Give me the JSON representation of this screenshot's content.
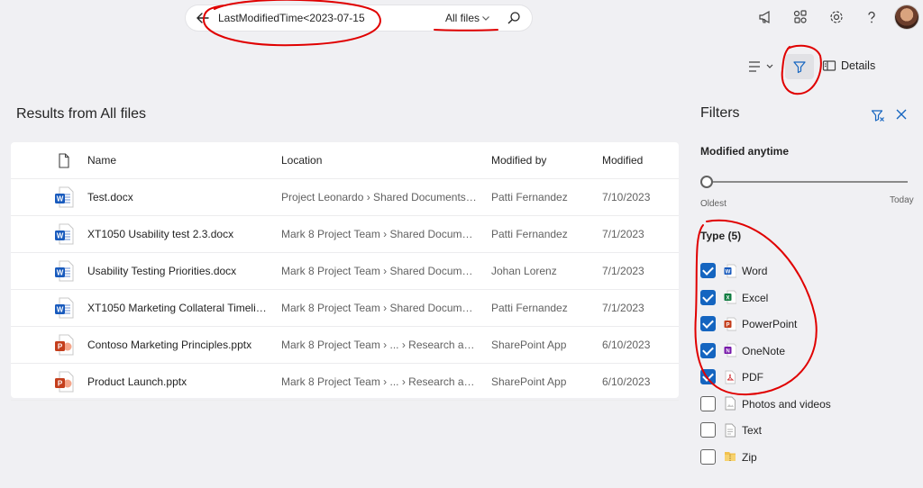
{
  "search": {
    "query": "LastModifiedTime<2023-07-15",
    "scope": "All files"
  },
  "toolbar": {
    "details_label": "Details"
  },
  "results": {
    "title": "Results from All files",
    "columns": [
      "Name",
      "Location",
      "Modified by",
      "Modified"
    ],
    "rows": [
      {
        "type": "word",
        "name": "Test.docx",
        "location": "Project Leonardo › Shared Documents ›...",
        "modified_by": "Patti Fernandez",
        "modified": "7/10/2023"
      },
      {
        "type": "word",
        "name": "XT1050 Usability test 2.3.docx",
        "location": "Mark 8 Project Team › Shared Documents...",
        "modified_by": "Patti Fernandez",
        "modified": "7/1/2023"
      },
      {
        "type": "word",
        "name": "Usability Testing Priorities.docx",
        "location": "Mark 8 Project Team › Shared Documents...",
        "modified_by": "Johan Lorenz",
        "modified": "7/1/2023"
      },
      {
        "type": "word",
        "name": "XT1050 Marketing Collateral Timeline...",
        "location": "Mark 8 Project Team › Shared Documents...",
        "modified_by": "Patti Fernandez",
        "modified": "7/1/2023"
      },
      {
        "type": "powerpoint",
        "name": "Contoso Marketing Principles.pptx",
        "location": "Mark 8 Project Team › ... › Research and ...",
        "modified_by": "SharePoint App",
        "modified": "6/10/2023"
      },
      {
        "type": "powerpoint",
        "name": "Product Launch.pptx",
        "location": "Mark 8 Project Team › ... › Research and ...",
        "modified_by": "SharePoint App",
        "modified": "6/10/2023"
      }
    ]
  },
  "filters": {
    "title": "Filters",
    "modified": {
      "label": "Modified anytime",
      "min_label": "Oldest",
      "max_label": "Today",
      "level": 0
    },
    "type": {
      "label": "Type (5)",
      "options": [
        {
          "label": "Word",
          "checked": true,
          "icon": "word-icon"
        },
        {
          "label": "Excel",
          "checked": true,
          "icon": "excel-icon"
        },
        {
          "label": "PowerPoint",
          "checked": true,
          "icon": "powerpoint-icon"
        },
        {
          "label": "OneNote",
          "checked": true,
          "icon": "onenote-icon"
        },
        {
          "label": "PDF",
          "checked": true,
          "icon": "pdf-icon"
        },
        {
          "label": "Photos and videos",
          "checked": false,
          "icon": "photo-icon"
        },
        {
          "label": "Text",
          "checked": false,
          "icon": "text-file-icon"
        },
        {
          "label": "Zip",
          "checked": false,
          "icon": "zip-folder-icon"
        }
      ]
    }
  },
  "colors": {
    "accent": "#1565c0",
    "word": "#185abd",
    "excel": "#107c41",
    "powerpoint": "#c43e1c",
    "onenote": "#7719aa",
    "pdf": "#d13438",
    "annotation": "#e00000"
  }
}
